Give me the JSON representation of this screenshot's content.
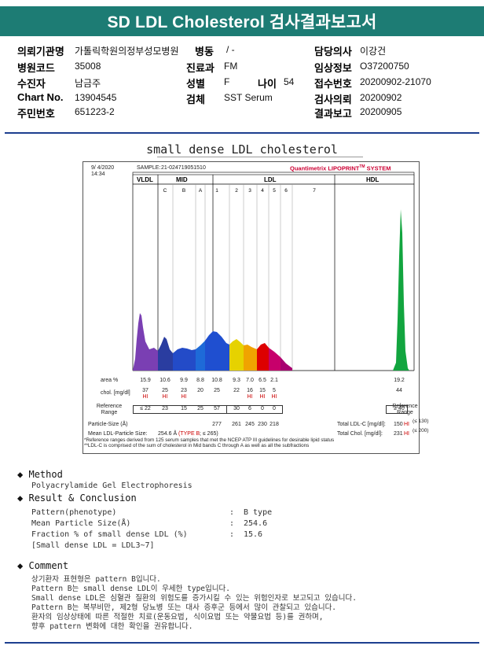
{
  "title": "SD LDL Cholesterol 검사결과보고서",
  "header": {
    "left": [
      {
        "label": "의뢰기관명",
        "value": "가톨릭학원의정부성모병원"
      },
      {
        "label": "병원코드",
        "value": "35008"
      },
      {
        "label": "수진자",
        "value": "남금주"
      },
      {
        "label": "Chart No.",
        "value": "13904545"
      },
      {
        "label": "주민번호",
        "value": "651223-2"
      }
    ],
    "mid": [
      {
        "label": "병동",
        "value": "/ -"
      },
      {
        "label": "진료과",
        "value": "FM"
      },
      {
        "label": "성별",
        "value": "F"
      },
      {
        "label": "검체",
        "value": "SST Serum"
      }
    ],
    "age": {
      "label": "나이",
      "value": "54"
    },
    "right": [
      {
        "label": "담당의사",
        "value": "이강건"
      },
      {
        "label": "임상정보",
        "value": "O37200750"
      },
      {
        "label": "접수번호",
        "value": "20200902-21070"
      },
      {
        "label": "검사의뢰",
        "value": "20200902"
      },
      {
        "label": "결과보고",
        "value": "20200905"
      }
    ]
  },
  "graph": {
    "heading": "small dense LDL cholesterol",
    "date": "9/ 4/2020",
    "time": "14:34",
    "sample_label": "SAMPLE:",
    "sample_id": "21-024719051510",
    "brand": "Quantimetrix LIPOPRINT",
    "brand_tm": "TM",
    "brand_suffix": " SYSTEM",
    "regions": {
      "vldl": "VLDL",
      "mid": "MID",
      "ldl": "LDL",
      "hdl": "HDL"
    },
    "bands": [
      "C",
      "B",
      "A",
      "1",
      "2",
      "3",
      "4",
      "5",
      "6",
      "7"
    ],
    "row_area_label": "area %",
    "row_chol_label": "chol. [mg/dl]",
    "row_ref_label": "Reference Range",
    "ref_range_right_label": "Reference Range",
    "particle_label": "Particle-Size (Å)",
    "mean_label": "Mean LDL-Particle Size:",
    "mean_value": "254.6 Å",
    "mean_type": "(TYPE B",
    "mean_limit": "; ≤ 265)",
    "total_ldl_label": "Total LDL-C [mg/dl]:",
    "total_ldl_value": "150",
    "total_ldl_flag": "HI",
    "total_ldl_ref": "(≤ 130)",
    "total_chol_label": "Total Chol. [mg/dl]:",
    "total_chol_value": "231",
    "total_chol_flag": "HI",
    "total_chol_ref": "(≤ 200)",
    "footnote1": "*Reference ranges derived from 125 serum samples that met the NCEP ATP III guidelines for desirable lipid status",
    "footnote2": "**LDL-C is comprised of the sum of cholesterol in Mid bands C through A as well as all the subfractions"
  },
  "chart_data": {
    "type": "table",
    "fractions": [
      "VLDL",
      "C",
      "B",
      "A",
      "1",
      "2",
      "3",
      "4",
      "5",
      "6",
      "7",
      "HDL"
    ],
    "area_percent": [
      "15.9",
      "10.6",
      "9.9",
      "8.8",
      "10.8",
      "9.3",
      "7.0",
      "6.5",
      "2.1",
      "",
      "",
      "19.2"
    ],
    "chol_mg_dl": [
      "37",
      "25",
      "23",
      "20",
      "25",
      "22",
      "16",
      "15",
      "5",
      "",
      "",
      "44"
    ],
    "chol_flags": [
      "HI",
      "HI",
      "HI",
      "",
      "",
      "",
      "HI",
      "HI",
      "HI",
      "",
      "",
      ""
    ],
    "reference_range": [
      "≤ 22",
      "23",
      "15",
      "25",
      "57",
      "30",
      "6",
      "0",
      "0",
      "",
      "",
      "≥ 40"
    ],
    "particle_size_A": [
      "",
      "",
      "",
      "",
      "277",
      "261",
      "245",
      "230",
      "218",
      "",
      "",
      ""
    ]
  },
  "method": {
    "heading": "Method",
    "text": "Polyacrylamide Gel Electrophoresis"
  },
  "result": {
    "heading": "Result & Conclusion",
    "rows": [
      {
        "label": "Pattern(phenotype)",
        "value": "B type"
      },
      {
        "label": "Mean Particle Size(Å)",
        "value": "254.6"
      },
      {
        "label": "Fraction % of small dense LDL (%)",
        "value": "15.6"
      }
    ],
    "note": "[Small dense LDL = LDL3~7]"
  },
  "comment": {
    "heading": "Comment",
    "lines": [
      "상기환자 표현형은 pattern B입니다.",
      "Pattern B는 small dense LDL이 우세한 type입니다.",
      "Small dense LDL은 심혈관 질환의 위험도를 증가시킬 수 있는 위험인자로 보고되고 있습니다.",
      "Pattern B는 복부비만, 제2형 당뇨병 또는 대사 증후군 등에서 많이 관찰되고 있습니다.",
      "환자의 임상상태에 따른 적절한 치료(운동요법, 식이요법 또는 약물요법 등)를 권하며,",
      "향후 pattern 변화에 대한 확인을 권유합니다."
    ]
  },
  "colors": {
    "title_bg": "#1d7c74",
    "rule": "#1d3f8f",
    "flag": "#cc0000",
    "brand": "#cc0033"
  }
}
